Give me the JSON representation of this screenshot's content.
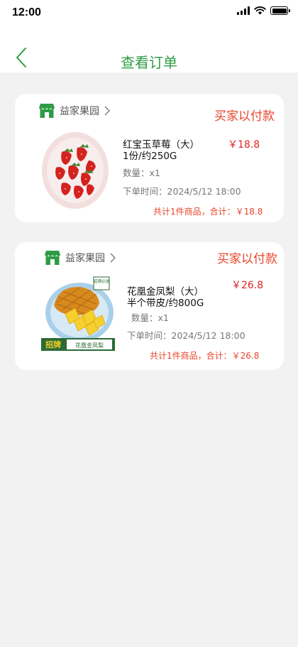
{
  "status_bar": {
    "time": "12:00"
  },
  "nav": {
    "title": "查看订单"
  },
  "colors": {
    "brand_green": "#2e9c45",
    "status_red": "#e8452c",
    "price_red": "#e0231f"
  },
  "orders": [
    {
      "shop_name": "益家果园",
      "status": "买家以付款",
      "product_name_line1": "红宝玉草莓（大）",
      "product_name_line2": "1份/约250G",
      "price": "￥18.8",
      "quantity": "数量：x1",
      "order_time": "下单时间：2024/5/12 18:00",
      "summary": "共计1件商品，合计：￥18.8",
      "image": "strawberry-plate"
    },
    {
      "shop_name": "益家果园",
      "status": "买家以付款",
      "product_name_line1": "花凰金凤梨（大）",
      "product_name_line2": "半个带皮/约800G",
      "price": "￥26.8",
      "quantity": "数量：x1",
      "order_time": "下单时间：2024/5/12 18:00",
      "summary": "共计1件商品，合计：￥26.8",
      "image": "pineapple-plate",
      "image_badge_main": "招牌",
      "image_badge_tag": "招牌必选",
      "image_caption": "花凰金凤梨"
    }
  ]
}
